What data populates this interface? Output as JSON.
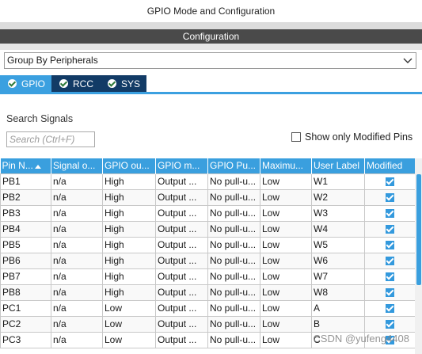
{
  "window": {
    "title": "GPIO Mode and Configuration"
  },
  "configuration_bar": {
    "label": "Configuration"
  },
  "group_select": {
    "value": "Group By Peripherals"
  },
  "tabs": [
    {
      "label": "GPIO",
      "active": true
    },
    {
      "label": "RCC",
      "active": false
    },
    {
      "label": "SYS",
      "active": false
    }
  ],
  "search": {
    "label": "Search Signals",
    "placeholder": "Search (Ctrl+F)"
  },
  "show_modified": {
    "label": "Show only Modified Pins",
    "checked": false
  },
  "table": {
    "headers": [
      "Pin N...",
      "Signal o...",
      "GPIO ou...",
      "GPIO m...",
      "GPIO Pu...",
      "Maximu...",
      "User Label",
      "Modified"
    ],
    "rows": [
      {
        "pin": "PB1",
        "signal": "n/a",
        "output": "High",
        "mode": "Output ...",
        "pull": "No pull-u...",
        "speed": "Low",
        "label": "W1",
        "modified": true
      },
      {
        "pin": "PB2",
        "signal": "n/a",
        "output": "High",
        "mode": "Output ...",
        "pull": "No pull-u...",
        "speed": "Low",
        "label": "W2",
        "modified": true
      },
      {
        "pin": "PB3",
        "signal": "n/a",
        "output": "High",
        "mode": "Output ...",
        "pull": "No pull-u...",
        "speed": "Low",
        "label": "W3",
        "modified": true
      },
      {
        "pin": "PB4",
        "signal": "n/a",
        "output": "High",
        "mode": "Output ...",
        "pull": "No pull-u...",
        "speed": "Low",
        "label": "W4",
        "modified": true
      },
      {
        "pin": "PB5",
        "signal": "n/a",
        "output": "High",
        "mode": "Output ...",
        "pull": "No pull-u...",
        "speed": "Low",
        "label": "W5",
        "modified": true
      },
      {
        "pin": "PB6",
        "signal": "n/a",
        "output": "High",
        "mode": "Output ...",
        "pull": "No pull-u...",
        "speed": "Low",
        "label": "W6",
        "modified": true
      },
      {
        "pin": "PB7",
        "signal": "n/a",
        "output": "High",
        "mode": "Output ...",
        "pull": "No pull-u...",
        "speed": "Low",
        "label": "W7",
        "modified": true
      },
      {
        "pin": "PB8",
        "signal": "n/a",
        "output": "High",
        "mode": "Output ...",
        "pull": "No pull-u...",
        "speed": "Low",
        "label": "W8",
        "modified": true
      },
      {
        "pin": "PC1",
        "signal": "n/a",
        "output": "Low",
        "mode": "Output ...",
        "pull": "No pull-u...",
        "speed": "Low",
        "label": "A",
        "modified": true
      },
      {
        "pin": "PC2",
        "signal": "n/a",
        "output": "Low",
        "mode": "Output ...",
        "pull": "No pull-u...",
        "speed": "Low",
        "label": "B",
        "modified": true
      },
      {
        "pin": "PC3",
        "signal": "n/a",
        "output": "Low",
        "mode": "Output ...",
        "pull": "No pull-u...",
        "speed": "Low",
        "label": "C",
        "modified": true
      }
    ]
  },
  "watermark": "CSDN @yufeng4408",
  "colors": {
    "accent": "#3a9fde",
    "tab_inactive": "#123b66",
    "config_bar": "#4a4a4a"
  },
  "icons": {
    "tab_status": "check-circle-icon",
    "select_arrow": "chevron-down-icon",
    "sort": "sort-up-icon",
    "row_modified": "checkbox-checked-icon"
  }
}
